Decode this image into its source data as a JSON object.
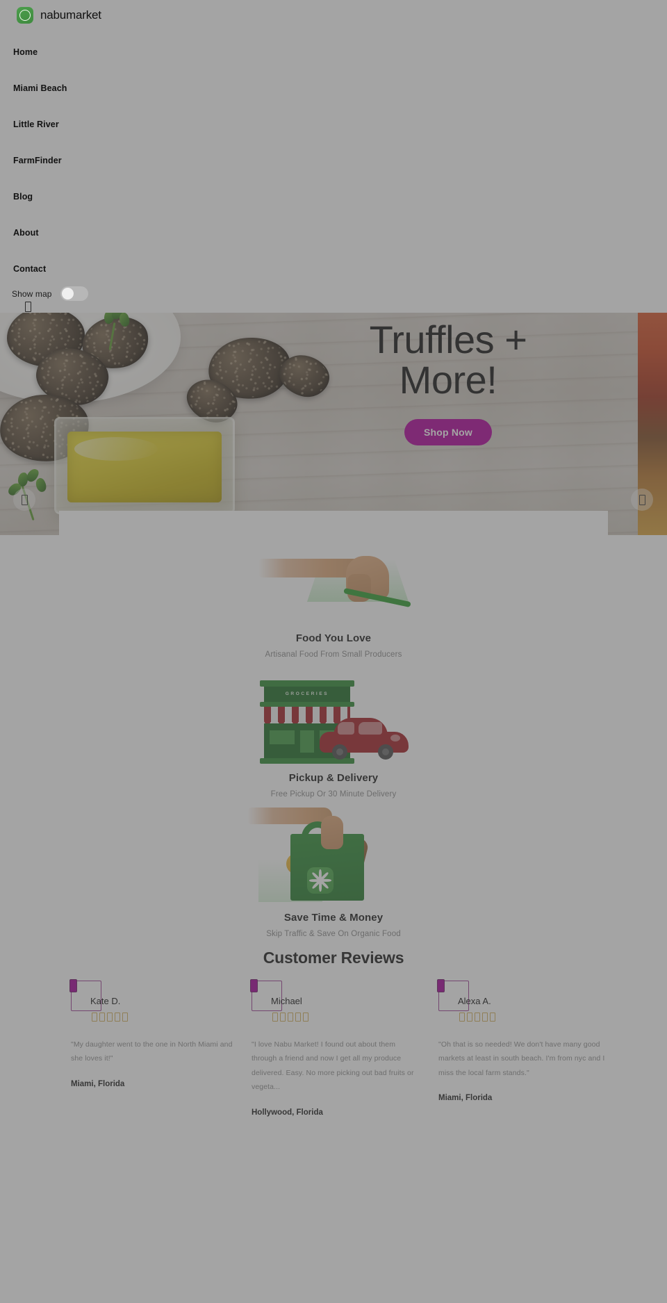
{
  "brand": {
    "name": "nabumarket",
    "logo_icon": "nabu-petal-logo-icon",
    "accent": "#3f8b3f"
  },
  "nav": {
    "items": [
      {
        "label": "Home"
      },
      {
        "label": "Miami Beach"
      },
      {
        "label": "Little River"
      },
      {
        "label": "FarmFinder"
      },
      {
        "label": "Blog"
      },
      {
        "label": "About"
      },
      {
        "label": "Contact"
      }
    ],
    "map_toggle": {
      "label": "Show map",
      "state": "off"
    },
    "menu_icon": "hamburger-menu-icon"
  },
  "hero": {
    "title_line1": "Truffles +",
    "title_line2": "More!",
    "cta_label": "Shop Now",
    "cta_color": "#b0009b",
    "prev_icon": "chevron-left-icon",
    "next_icon": "chevron-right-icon",
    "glyph": "□"
  },
  "features": [
    {
      "art": "hand-tapping-green-card-icon",
      "title": "Food You Love",
      "subtitle": "Artisanal Food From Small Producers"
    },
    {
      "art": "grocery-store-and-car-icon",
      "store_sign": "GROCERIES",
      "title": "Pickup & Delivery",
      "subtitle": "Free Pickup Or 30 Minute Delivery"
    },
    {
      "art": "grocery-bag-with-produce-icon",
      "title": "Save Time & Money",
      "subtitle": "Skip Traffic & Save On Organic Food"
    }
  ],
  "reviews": {
    "heading": "Customer Reviews",
    "star_glyph": "□",
    "items": [
      {
        "name": "Kate D.",
        "stars": 5,
        "text": "\"My daughter went to the one in North Miami and she loves it!\"",
        "location": "Miami, Florida"
      },
      {
        "name": "Michael",
        "stars": 5,
        "text": "\"I love Nabu Market! I found out about them through a friend and now I get all my produce delivered. Easy. No more picking out bad fruits or vegeta...",
        "location": "Hollywood, Florida"
      },
      {
        "name": "Alexa A.",
        "stars": 5,
        "text": "\"Oh that is so needed! We don't have many good markets at least in south beach. I'm from nyc and I miss the local farm stands.\"",
        "location": "Miami, Florida"
      }
    ]
  }
}
